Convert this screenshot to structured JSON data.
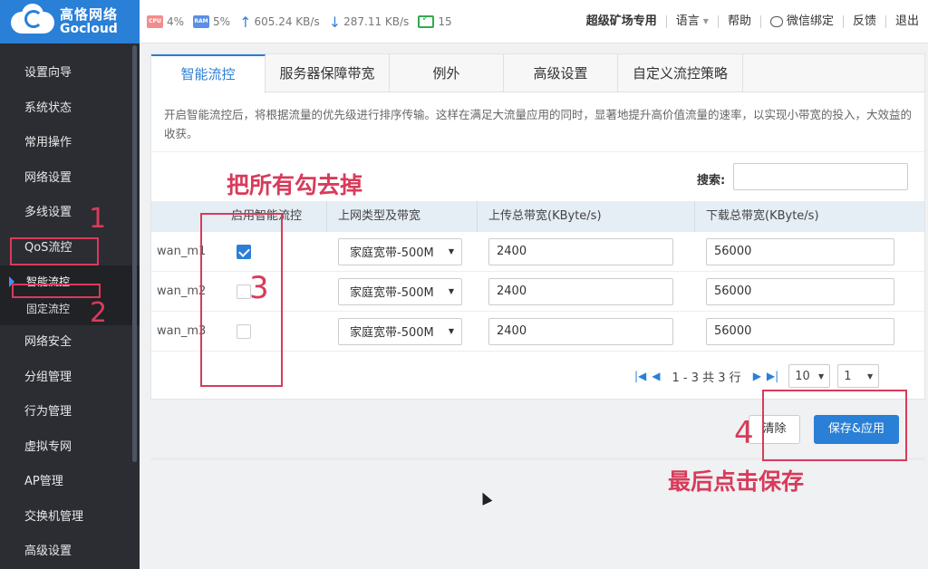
{
  "logo": {
    "cn": "高恪网络",
    "en": "Gocloud"
  },
  "stats": {
    "cpu_chip": "CPU",
    "cpu": "4%",
    "ram_chip": "RAM",
    "ram": "5%",
    "upload": "605.24 KB/s",
    "download": "287.11 KB/s",
    "devices": "15"
  },
  "topnav": {
    "edition": "超级矿场专用",
    "language": "语言",
    "help": "帮助",
    "wechat": "微信绑定",
    "feedback": "反馈",
    "logout": "退出"
  },
  "sidebar": {
    "items": [
      "设置向导",
      "系统状态",
      "常用操作",
      "网络设置",
      "多线设置",
      "QoS流控"
    ],
    "sub_items": [
      "智能流控",
      "固定流控"
    ],
    "items_after": [
      "网络安全",
      "分组管理",
      "行为管理",
      "虚拟专网",
      "AP管理",
      "交换机管理",
      "高级设置"
    ]
  },
  "tabs": [
    "智能流控",
    "服务器保障带宽",
    "例外",
    "高级设置",
    "自定义流控策略"
  ],
  "description": "开启智能流控后，将根据流量的优先级进行排序传输。这样在满足大流量应用的同时，显著地提升高价值流量的速率，以实现小带宽的投入，大效益的收获。",
  "search": {
    "label": "搜索:",
    "value": ""
  },
  "table": {
    "headers": [
      "",
      "启用智能流控",
      "上网类型及带宽",
      "上传总带宽(KByte/s)",
      "下载总带宽(KByte/s)"
    ],
    "rows": [
      {
        "name": "wan_m1",
        "enabled": true,
        "type": "家庭宽带-500M",
        "upload": "2400",
        "download": "56000"
      },
      {
        "name": "wan_m2",
        "enabled": false,
        "type": "家庭宽带-500M",
        "upload": "2400",
        "download": "56000"
      },
      {
        "name": "wan_m3",
        "enabled": false,
        "type": "家庭宽带-500M",
        "upload": "2400",
        "download": "56000"
      }
    ]
  },
  "pager": {
    "info": "1 - 3 共 3 行",
    "page_size": "10",
    "page": "1"
  },
  "actions": {
    "clear": "清除",
    "save": "保存&应用"
  },
  "annotations": {
    "uncheck_all": "把所有勾去掉",
    "step1": "1",
    "step2": "2",
    "step3": "3",
    "step4": "4",
    "final_save": "最后点击保存",
    "color": "#d83b5a"
  },
  "colors": {
    "accent": "#2a7fd6",
    "sidebar_bg": "#2b2d33"
  }
}
